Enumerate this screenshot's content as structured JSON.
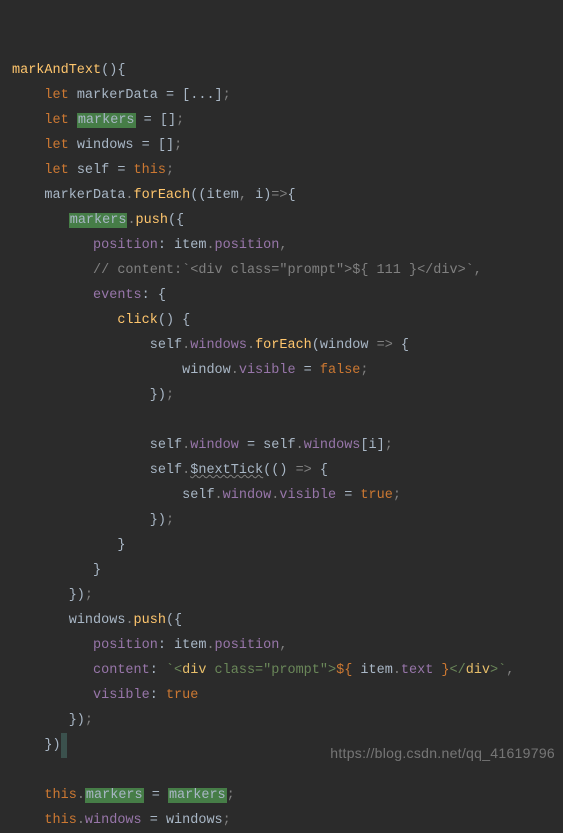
{
  "watermark": "https://blog.csdn.net/qq_41619796",
  "code": {
    "fn_markAndText": "markAndText",
    "kw_let": "let",
    "kw_this": "this",
    "kw_true": "true",
    "kw_false": "false",
    "v_markerData": "markerData",
    "v_markers": "markers",
    "v_windows": "windows",
    "v_self": "self",
    "v_item": "item",
    "v_i": "i",
    "v_window": "window",
    "m_forEach": "forEach",
    "m_push": "push",
    "m_click": "click",
    "m_nextTick": "$nextTick",
    "p_position": "position",
    "p_events": "events",
    "p_visible": "visible",
    "p_content": "content",
    "p_text": "text",
    "cmt_line": "// content:`<div class=\"prompt\">${ 111 }</div>`,",
    "tpl_open": "`<",
    "tpl_div": "div",
    "tpl_class": " class=",
    "tpl_prompt": "\"prompt\"",
    "tpl_gt": ">",
    "tpl_exp_open": "${ ",
    "tpl_exp_close": " }",
    "tpl_close_lt": "</",
    "tpl_close_gt": ">`",
    "arr_spread": "[...]"
  }
}
